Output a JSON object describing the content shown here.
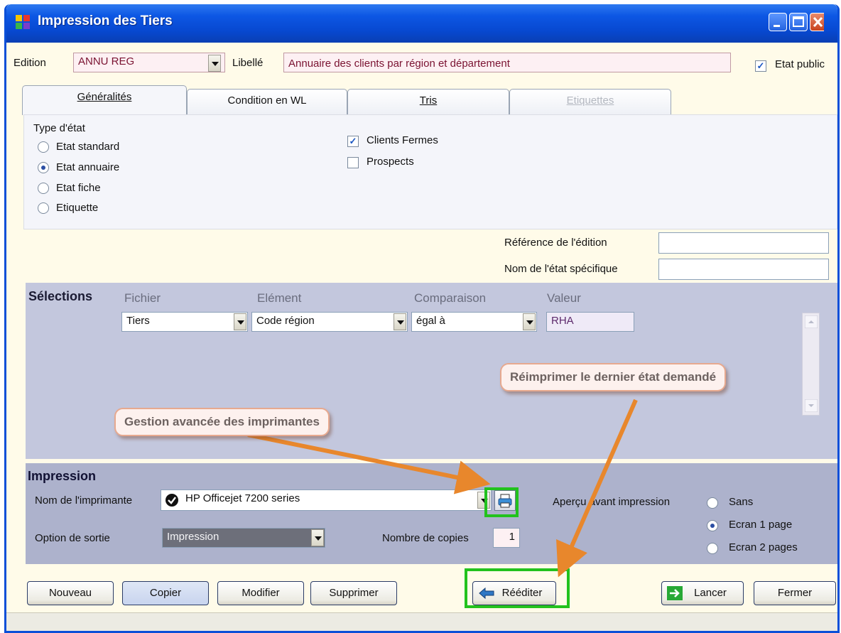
{
  "window": {
    "title": "Impression des Tiers"
  },
  "header": {
    "edition_label": "Edition",
    "edition_value": "ANNU REG",
    "libelle_label": "Libellé",
    "libelle_value": "Annuaire des clients par région et département",
    "etat_public_label": "Etat public",
    "etat_public_checked": true
  },
  "tabs": [
    {
      "label": "Généralités",
      "state": "active"
    },
    {
      "label": "Condition en WL",
      "state": "normal"
    },
    {
      "label": "Tris",
      "state": "normal"
    },
    {
      "label": "Etiquettes",
      "state": "disabled"
    }
  ],
  "generalites": {
    "type_etat_label": "Type d'état",
    "type_options": [
      {
        "label": "Etat standard",
        "selected": false
      },
      {
        "label": "Etat annuaire",
        "selected": true
      },
      {
        "label": "Etat fiche",
        "selected": false
      },
      {
        "label": "Etiquette",
        "selected": false
      }
    ],
    "checkboxes": [
      {
        "label": "Clients Fermes",
        "checked": true
      },
      {
        "label": "Prospects",
        "checked": false
      }
    ],
    "reference_label": "Référence de l'édition",
    "reference_value": "",
    "nom_etat_label": "Nom de l'état spécifique",
    "nom_etat_value": ""
  },
  "selections": {
    "title": "Sélections",
    "columns": [
      "Fichier",
      "Elément",
      "Comparaison",
      "Valeur"
    ],
    "row": {
      "fichier": "Tiers",
      "element": "Code région",
      "comparaison": "égal à",
      "valeur": "RHA"
    }
  },
  "impression": {
    "title": "Impression",
    "printer_label": "Nom de l'imprimante",
    "printer_value": "HP Officejet 7200 series",
    "sortie_label": "Option de sortie",
    "sortie_value": "Impression",
    "copies_label": "Nombre de copies",
    "copies_value": "1",
    "apercu_label": "Aperçu avant impression",
    "apercu_options": [
      {
        "label": "Sans",
        "selected": false
      },
      {
        "label": "Ecran 1 page",
        "selected": true
      },
      {
        "label": "Ecran 2 pages",
        "selected": false
      }
    ]
  },
  "buttons": {
    "nouveau": "Nouveau",
    "copier": "Copier",
    "modifier": "Modifier",
    "supprimer": "Supprimer",
    "reediter": "Rééditer",
    "lancer": "Lancer",
    "fermer": "Fermer"
  },
  "annotations": {
    "reimprimer": "Réimprimer le dernier état demandé",
    "gestion": "Gestion avancée des imprimantes"
  },
  "colors": {
    "titlebar": "#0748d0",
    "window_bg": "#fffbe9",
    "selections_bg": "#c3c7dd",
    "impression_bg": "#adb2cc",
    "highlight_green": "#22c21d",
    "arrow_orange": "#e8872c"
  }
}
